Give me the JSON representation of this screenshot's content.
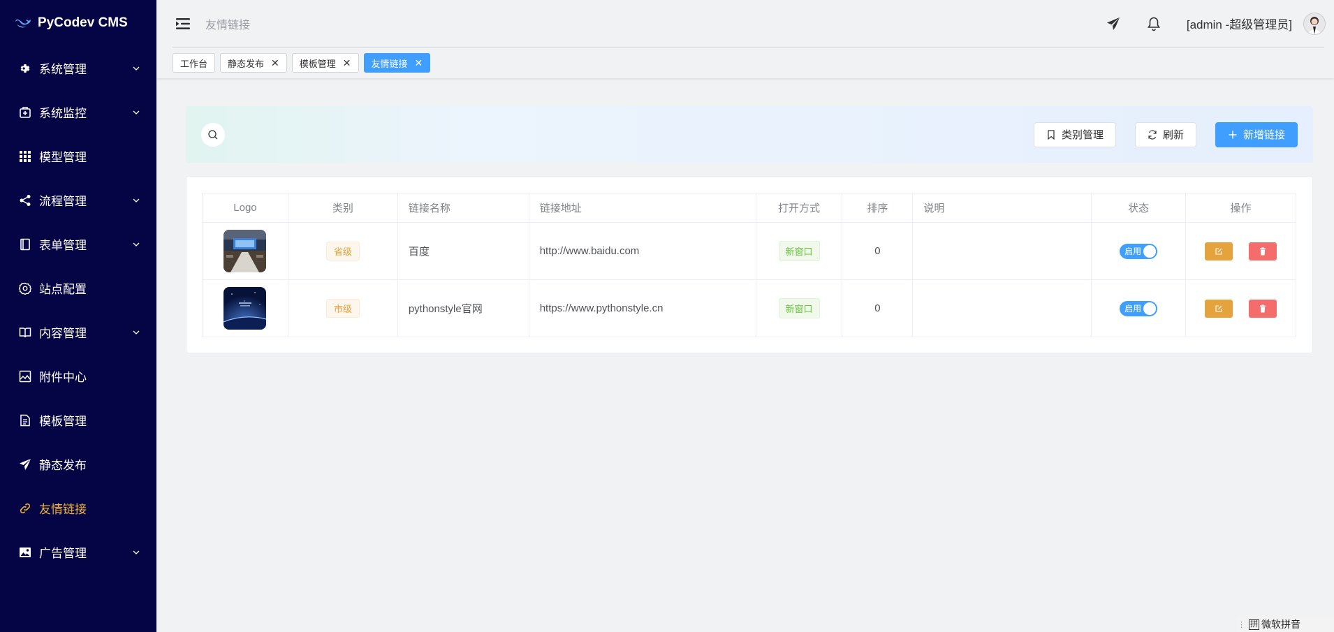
{
  "brand": {
    "name": "PyCodev CMS"
  },
  "sidebar": {
    "items": [
      {
        "label": "系统管理",
        "icon": "gear-icon",
        "has_children": true,
        "active": false
      },
      {
        "label": "系统监控",
        "icon": "monitor-plus-icon",
        "has_children": true,
        "active": false
      },
      {
        "label": "模型管理",
        "icon": "grid-icon",
        "has_children": false,
        "active": false
      },
      {
        "label": "流程管理",
        "icon": "share-icon",
        "has_children": true,
        "active": false
      },
      {
        "label": "表单管理",
        "icon": "form-book-icon",
        "has_children": true,
        "active": false
      },
      {
        "label": "站点配置",
        "icon": "setting-icon",
        "has_children": false,
        "active": false
      },
      {
        "label": "内容管理",
        "icon": "open-book-icon",
        "has_children": true,
        "active": false
      },
      {
        "label": "附件中心",
        "icon": "picture-icon",
        "has_children": false,
        "active": false
      },
      {
        "label": "模板管理",
        "icon": "document-icon",
        "has_children": false,
        "active": false
      },
      {
        "label": "静态发布",
        "icon": "send-icon",
        "has_children": false,
        "active": false
      },
      {
        "label": "友情链接",
        "icon": "link-icon",
        "has_children": false,
        "active": true
      },
      {
        "label": "广告管理",
        "icon": "image-icon",
        "has_children": true,
        "active": false
      }
    ]
  },
  "header": {
    "breadcrumb": "友情链接",
    "user": "[admin -超级管理员]"
  },
  "tabs": [
    {
      "label": "工作台",
      "closable": false,
      "active": false
    },
    {
      "label": "静态发布",
      "closable": true,
      "active": false
    },
    {
      "label": "模板管理",
      "closable": true,
      "active": false
    },
    {
      "label": "友情链接",
      "closable": true,
      "active": true
    }
  ],
  "toolbar": {
    "category_label": "类别管理",
    "refresh_label": "刷新",
    "add_label": "新增链接"
  },
  "table": {
    "columns": [
      "Logo",
      "类别",
      "链接名称",
      "链接地址",
      "打开方式",
      "排序",
      "说明",
      "状态",
      "操作"
    ],
    "rows": [
      {
        "category": "省级",
        "name": "百度",
        "url": "http://www.baidu.com",
        "open_mode": "新窗口",
        "sort": "0",
        "desc": "",
        "status": "启用"
      },
      {
        "category": "市级",
        "name": "pythonstyle官网",
        "url": "https://www.pythonstyle.cn",
        "open_mode": "新窗口",
        "sort": "0",
        "desc": "",
        "status": "启用"
      }
    ]
  },
  "ime": {
    "mode": "拼",
    "label": "微软拼音"
  },
  "colors": {
    "sidebar_bg": "#050545",
    "active_menu": "#f0b43a",
    "primary": "#409eff",
    "warning": "#e6a23c",
    "danger": "#f56c6c"
  }
}
